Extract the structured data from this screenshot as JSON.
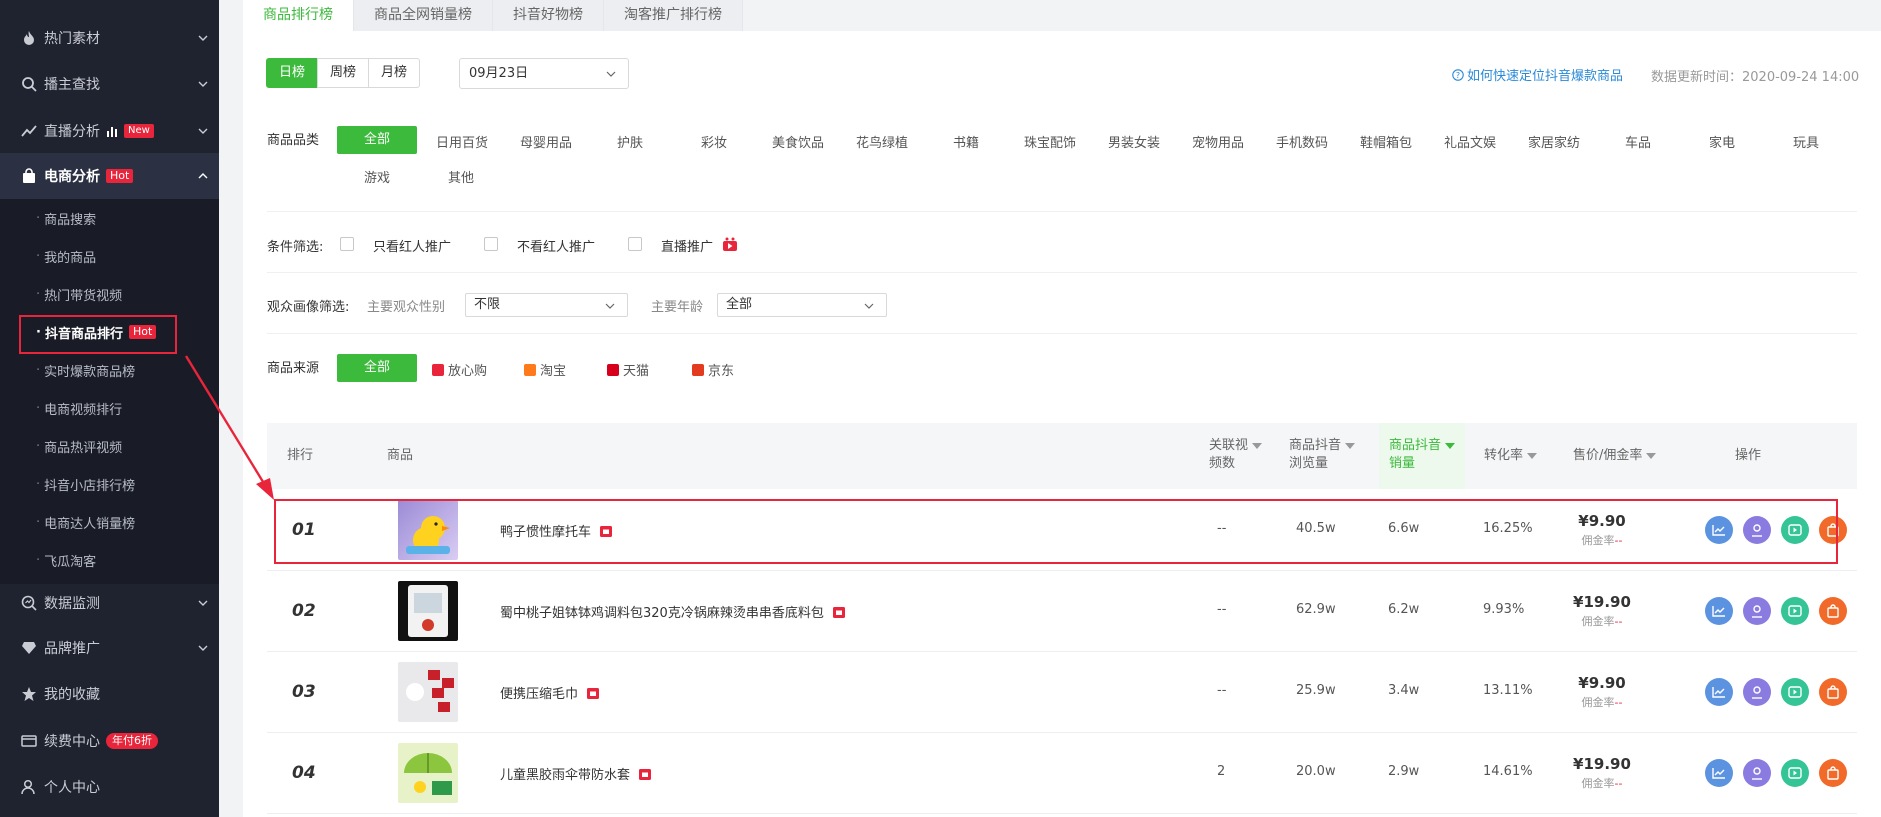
{
  "sidebar": {
    "items": [
      {
        "label": "热门素材"
      },
      {
        "label": "播主查找"
      },
      {
        "label": "直播分析",
        "badge": "New"
      },
      {
        "label": "电商分析",
        "badge": "Hot"
      },
      {
        "label": "数据监测"
      },
      {
        "label": "品牌推广"
      },
      {
        "label": "我的收藏"
      },
      {
        "label": "续费中心",
        "badge": "年付6折"
      },
      {
        "label": "个人中心"
      }
    ],
    "sub_items": [
      {
        "label": "商品搜索"
      },
      {
        "label": "我的商品"
      },
      {
        "label": "热门带货视频"
      },
      {
        "label": "抖音商品排行",
        "badge": "Hot"
      },
      {
        "label": "实时爆款商品榜"
      },
      {
        "label": "电商视频排行"
      },
      {
        "label": "商品热评视频"
      },
      {
        "label": "抖音小店排行榜"
      },
      {
        "label": "电商达人销量榜"
      },
      {
        "label": "飞瓜淘客"
      }
    ],
    "dot": "·"
  },
  "tabs": [
    {
      "label": "商品排行榜"
    },
    {
      "label": "商品全网销量榜"
    },
    {
      "label": "抖音好物榜"
    },
    {
      "label": "淘客推广排行榜"
    }
  ],
  "period": {
    "buttons": [
      "日榜",
      "周榜",
      "月榜"
    ],
    "date": "09月23日"
  },
  "help_link": "如何快速定位抖音爆款商品",
  "update_time": "数据更新时间：2020-09-24 14:00",
  "filters": {
    "category_label": "商品品类",
    "categories_row1": [
      "全部",
      "日用百货",
      "母婴用品",
      "护肤",
      "彩妆",
      "美食饮品",
      "花鸟绿植",
      "书籍",
      "珠宝配饰",
      "男装女装",
      "宠物用品",
      "手机数码",
      "鞋帽箱包",
      "礼品文娱",
      "家居家纺",
      "车品",
      "家电",
      "玩具"
    ],
    "categories_row2": [
      "游戏",
      "其他"
    ],
    "condition_label": "条件筛选:",
    "conditions": [
      "只看红人推广",
      "不看红人推广",
      "直播推广"
    ],
    "audience_label": "观众画像筛选:",
    "gender_label": "主要观众性别",
    "gender_value": "不限",
    "age_label": "主要年龄",
    "age_value": "全部",
    "source_label": "商品来源",
    "sources": [
      "全部",
      "放心购",
      "淘宝",
      "天猫",
      "京东"
    ]
  },
  "table": {
    "headers": {
      "rank": "排行",
      "product": "商品",
      "videos_l1": "关联视",
      "videos_l2": "频数",
      "views_l1": "商品抖音",
      "views_l2": "浏览量",
      "sales_l1": "商品抖音",
      "sales_l2": "销量",
      "conversion": "转化率",
      "price": "售价/佣金率",
      "ops": "操作"
    },
    "commission_label": "佣金率",
    "commission_value": "--",
    "rows": [
      {
        "rank": "01",
        "name": "鸭子惯性摩托车",
        "videos": "--",
        "views": "40.5w",
        "sales": "6.6w",
        "conversion": "16.25%",
        "price": "¥9.90"
      },
      {
        "rank": "02",
        "name": "蜀中桃子姐钵钵鸡调料包320克冷锅麻辣烫串串香底料包",
        "videos": "--",
        "views": "62.9w",
        "sales": "6.2w",
        "conversion": "9.93%",
        "price": "¥19.90"
      },
      {
        "rank": "03",
        "name": "便携压缩毛巾",
        "videos": "--",
        "views": "25.9w",
        "sales": "3.4w",
        "conversion": "13.11%",
        "price": "¥9.90"
      },
      {
        "rank": "04",
        "name": "儿童黑胶雨伞带防水套",
        "videos": "2",
        "views": "20.0w",
        "sales": "2.9w",
        "conversion": "14.61%",
        "price": "¥19.90"
      }
    ]
  },
  "colors": {
    "accent": "#3cba3c",
    "sidebar_bg": "#1f2330",
    "alert_red": "#e8253b",
    "link_blue": "#2a8ad8"
  }
}
